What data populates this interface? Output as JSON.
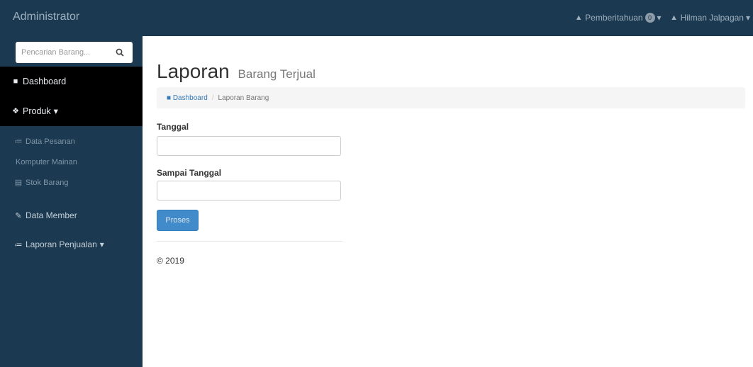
{
  "navbar": {
    "brand": "Administrator",
    "notifications_label": "Pemberitahuan",
    "notifications_count": "0",
    "user_label": "Hilman Jalpagan"
  },
  "sidebar": {
    "search_placeholder": "Pencarian Barang...",
    "items": [
      {
        "label": "Dashboard",
        "icon": "dashboard-icon"
      },
      {
        "label": "Produk",
        "icon": "cubes-icon"
      },
      {
        "label": "Data Pesanan",
        "icon": "chart-icon"
      },
      {
        "label": "Komputer Mainan"
      },
      {
        "label": "Stok Barang",
        "icon": "table-icon"
      },
      {
        "label": "Data Member",
        "icon": "edit-icon"
      },
      {
        "label": "Laporan Penjualan",
        "icon": "chart-icon"
      }
    ]
  },
  "main": {
    "title": "Laporan",
    "subtitle": "Barang Terjual",
    "breadcrumb": [
      "Dashboard",
      "Laporan Barang"
    ],
    "form": {
      "date_label": "Tanggal",
      "date_value": "",
      "until_label": "Sampai Tanggal",
      "until_value": "",
      "submit_label": "Proses"
    },
    "footer": "© 2019"
  },
  "colors": {
    "navbar": "#1b3a52",
    "sidebar": "#1b3a52",
    "active_item": "#000000",
    "primary_button": "#428bca"
  }
}
